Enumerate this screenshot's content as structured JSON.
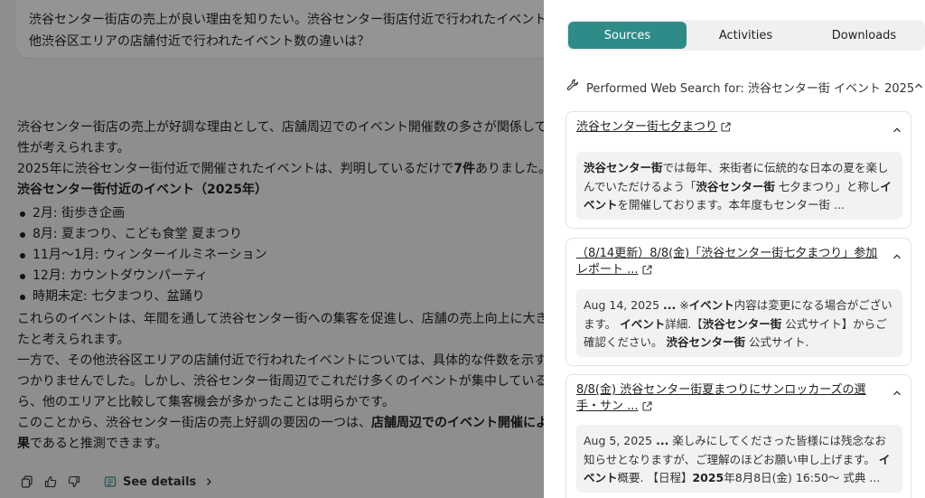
{
  "chat": {
    "user_message": {
      "line1": "渋谷センター街店の売上が良い理由を知りたい。渋谷センター街店付近で行われたイベント",
      "line2": "他渋谷区エリアの店舗付近で行われたイベント数の違いは？"
    },
    "answer": {
      "p1_line1": "渋谷センター街店の売上が好調な理由として、店舗周辺でのイベント開催数の多さが関係して",
      "p1_line2": "性が考えられます。",
      "p2_prefix": "2025年に渋谷センター街付近で開催されたイベントは、判明しているだけで",
      "p2_bold": "7件",
      "p2_suffix": "ありました。",
      "heading": "渋谷センター街付近のイベント（2025年）",
      "events": [
        "2月: 街歩き企画",
        "8月: 夏まつり、こども食堂 夏まつり",
        "11月〜1月: ウィンターイルミネーション",
        "12月: カウントダウンパーティ",
        "時期未定: 七夕まつり、盆踊り"
      ],
      "p3_line1": "これらのイベントは、年間を通して渋谷センター街への集客を促進し、店舗の売上向上に大き",
      "p3_line2": "たと考えられます。",
      "p4_line1": "一方で、その他渋谷区エリアの店舗付近で行われたイベントについては、具体的な件数を示す",
      "p4_line2": "つかりませんでした。しかし、渋谷センター街周辺でこれだけ多くのイベントが集中している",
      "p4_line3": "ら、他のエリアと比較して集客機会が多かったことは明らかです。",
      "p5_line1_prefix": "このことから、渋谷センター街店の売上好調の要因の一つは、",
      "p5_line1_bold": "店舗周辺でのイベント開催によ",
      "p5_line2_bold": "果",
      "p5_line2_suffix": "であると推測できます。"
    },
    "actions": {
      "see_details": "See details"
    }
  },
  "panel": {
    "tabs": [
      "Sources",
      "Activities",
      "Downloads"
    ],
    "active_tab": "Sources",
    "search": {
      "label": "Performed Web Search for: 渋谷センター街 イベント 2025"
    },
    "sources": [
      {
        "title": "渋谷センター街七夕まつり",
        "snippet": [
          {
            "b": "渋谷センター街"
          },
          {
            "t": "では毎年、来街者に伝統的な日本の夏を楽しんでいただけるよう「"
          },
          {
            "b": "渋谷センター街"
          },
          {
            "t": " 七夕まつり」と称し"
          },
          {
            "b": "イベント"
          },
          {
            "t": "を開催しております。本年度もセンター街 ..."
          }
        ]
      },
      {
        "title": "（8/14更新）8/8(金)「渋谷センター街七夕まつり」参加レポート ...",
        "snippet": [
          {
            "t": "Aug 14, 2025 "
          },
          {
            "b": "..."
          },
          {
            "t": " ※"
          },
          {
            "b": "イベント"
          },
          {
            "t": "内容は変更になる場合がございます。 "
          },
          {
            "b": "イベント"
          },
          {
            "t": "詳細.【"
          },
          {
            "b": "渋谷センター街"
          },
          {
            "t": " 公式サイト】からご確認ください。 "
          },
          {
            "b": "渋谷センター街"
          },
          {
            "t": " 公式サイト."
          }
        ]
      },
      {
        "title": "8/8(金) 渋谷センター街夏まつりにサンロッカーズの選手・サン ...",
        "snippet": [
          {
            "t": "Aug 5, 2025 "
          },
          {
            "b": "..."
          },
          {
            "t": " 楽しみにしてくださった皆様には残念なお知らせとなりますが、ご理解のほどお願い申し上げます。 "
          },
          {
            "b": "イベント"
          },
          {
            "t": "概要. 【日程】"
          },
          {
            "b": "2025"
          },
          {
            "t": "年8月8日(金) 16:50〜 式典 ..."
          }
        ]
      }
    ]
  },
  "colors": {
    "accent": "#2e8b88",
    "overlay": "rgba(0,0,0,0.42)"
  },
  "icons": [
    "copy-icon",
    "thumbs-up-icon",
    "thumbs-down-icon",
    "details-icon",
    "chevron-right-icon",
    "wrench-icon",
    "chevron-up-icon",
    "external-link-icon"
  ]
}
